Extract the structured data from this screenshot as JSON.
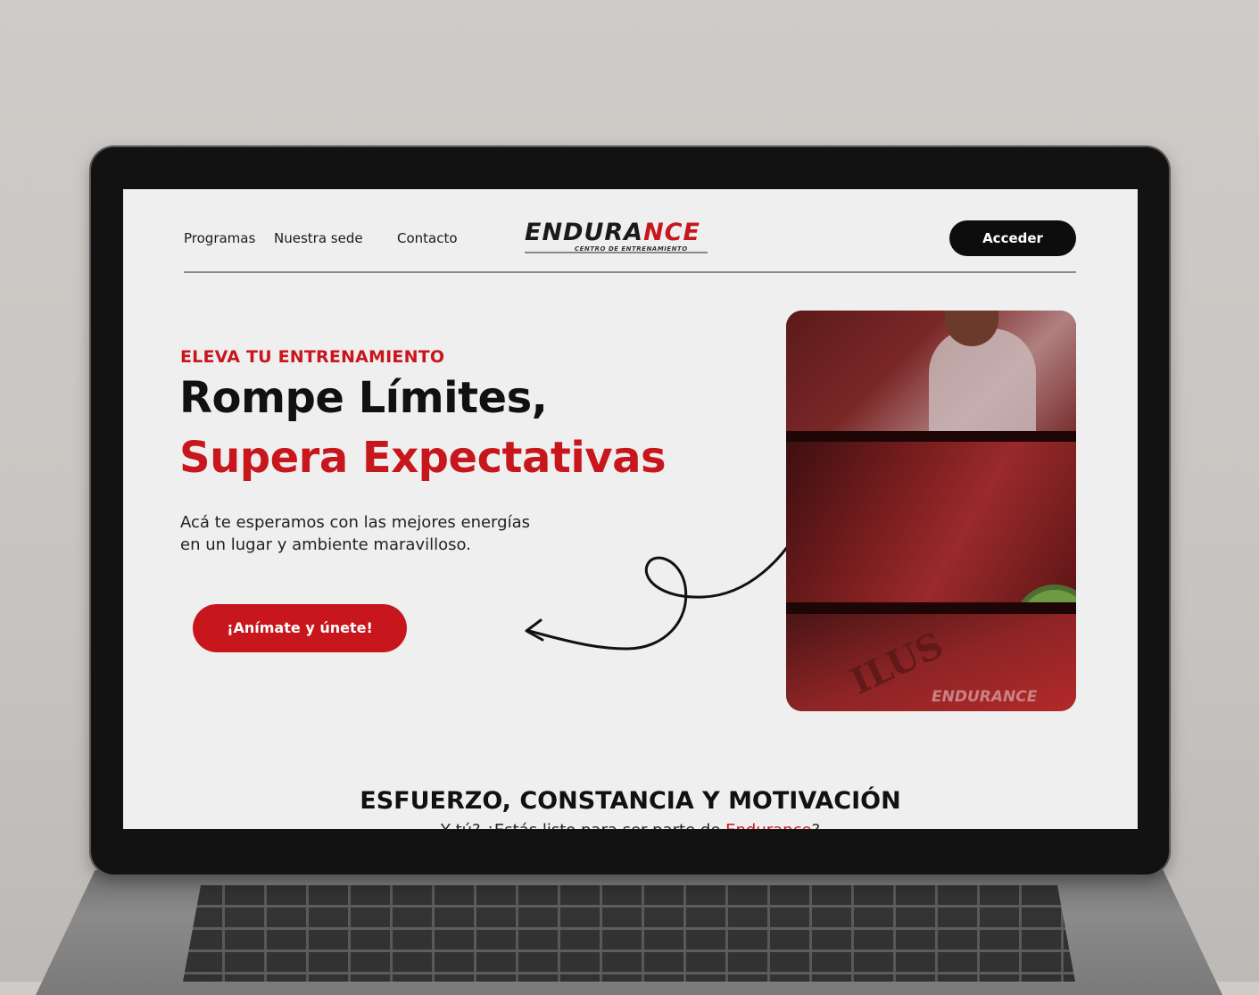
{
  "nav": {
    "programas": "Programas",
    "sede": "Nuestra sede",
    "contacto": "Contacto"
  },
  "logo": {
    "main_black": "ENDURA",
    "main_red": "NCE",
    "tagline": "CENTRO DE ENTRENAMIENTO"
  },
  "header": {
    "acceder_label": "Acceder"
  },
  "hero": {
    "eyebrow": "ELEVA TU ENTRENAMIENTO",
    "title_line1": "Rompe Límites,",
    "title_line2": "Supera Expectativas",
    "description": "Acá te esperamos con las mejores energías en un lugar y ambiente maravilloso.",
    "cta_label": "¡Anímate y únete!"
  },
  "collage": {
    "plate_text": "ILUS",
    "logo_watermark": "ENDURANCE"
  },
  "section": {
    "title": "ESFUERZO, CONSTANCIA Y MOTIVACIÓN",
    "subtitle_pre": "Y tú? ¿Estás listo para ser parte de ",
    "subtitle_brand": "Endurance",
    "subtitle_post": "?"
  },
  "colors": {
    "brand_red": "#c8161d",
    "dark": "#0d0d0d",
    "background": "#efefef"
  }
}
